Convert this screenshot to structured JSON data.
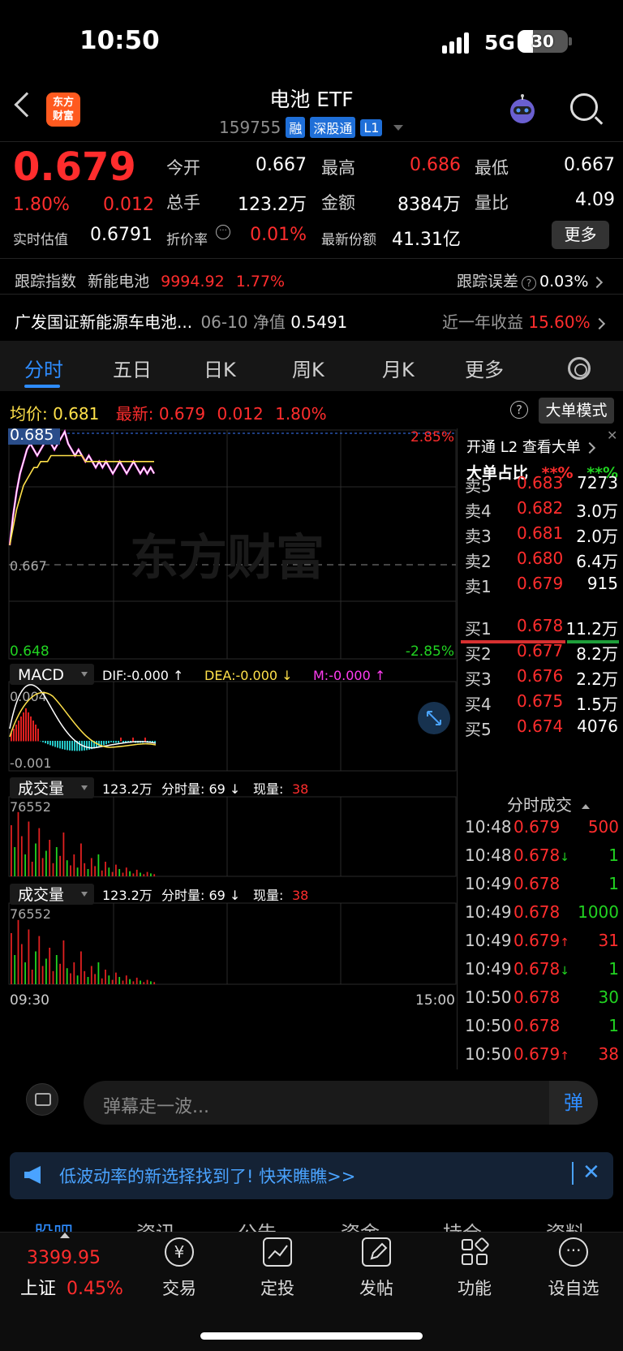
{
  "status": {
    "time": "10:50",
    "network": "5G",
    "battery": "30",
    "battery_level": 0.3
  },
  "header": {
    "title": "电池 ETF",
    "code": "159755",
    "tags": [
      "融",
      "深股通",
      "L1"
    ],
    "logo_text": "东方财富"
  },
  "quote": {
    "price": "0.679",
    "change_pct": "1.80%",
    "change_val": "0.012",
    "rows": [
      [
        {
          "label": "今开",
          "value": "0.667",
          "color": "white"
        },
        {
          "label": "最高",
          "value": "0.686",
          "color": "red"
        },
        {
          "label": "最低",
          "value": "0.667",
          "color": "white"
        }
      ],
      [
        {
          "label": "总手",
          "value": "123.2万",
          "color": "white"
        },
        {
          "label": "金额",
          "value": "8384万",
          "color": "white"
        },
        {
          "label": "量比",
          "value": "4.09",
          "color": "white"
        }
      ]
    ],
    "est_label": "实时估值",
    "est_value": "0.6791",
    "disc_label": "折价率",
    "disc_value": "0.01%",
    "share_label": "最新份额",
    "share_value": "41.31亿",
    "more": "更多"
  },
  "tracking": {
    "label": "跟踪指数",
    "index": "新能电池",
    "value": "9994.92",
    "pct": "1.77%",
    "err_label": "跟踪误差",
    "err_value": "0.03%"
  },
  "fund": {
    "name": "广发国证新能源车电池...",
    "date": "06-10",
    "nav_label": "净值",
    "nav": "0.5491",
    "ret_label": "近一年收益",
    "ret": "15.60%"
  },
  "tabs": [
    "分时",
    "五日",
    "日K",
    "周K",
    "月K",
    "更多"
  ],
  "avgline": {
    "avg_label": "均价:",
    "avg": "0.681",
    "latest_label": "最新:",
    "latest": "0.679",
    "chg": "0.012",
    "pct": "1.80%",
    "mode": "大单模式"
  },
  "chart": {
    "top_price": "0.685",
    "mid_price": "0.667",
    "low_price": "0.648",
    "top_pct": "2.85%",
    "low_pct": "-2.85%",
    "time_start": "09:30",
    "time_end": "15:00",
    "watermark": "东方财富",
    "macd": {
      "label": "MACD",
      "dif": "DIF:-0.000 ↑",
      "dea": "DEA:-0.000 ↓",
      "m": "M:-0.000 ↑",
      "top": "0.004",
      "low": "-0.001"
    },
    "volume": {
      "label": "成交量",
      "total": "123.2万",
      "fs_label": "分时量: 69 ↓",
      "now_label": "现量:",
      "now": "38",
      "max": "76552"
    }
  },
  "chart_data": {
    "type": "line",
    "price_range": [
      0.648,
      0.686
    ],
    "prev_close": 0.667,
    "price": [
      0.667,
      0.672,
      0.676,
      0.679,
      0.681,
      0.683,
      0.684,
      0.683,
      0.682,
      0.683,
      0.684,
      0.685,
      0.684,
      0.683,
      0.684,
      0.685,
      0.686,
      0.684,
      0.683,
      0.682,
      0.683,
      0.682,
      0.681,
      0.682,
      0.681,
      0.68,
      0.681,
      0.68,
      0.681,
      0.68,
      0.679,
      0.68,
      0.681,
      0.68,
      0.679,
      0.68,
      0.681,
      0.68,
      0.679,
      0.68,
      0.679,
      0.68,
      0.679
    ],
    "avg": [
      0.667,
      0.67,
      0.673,
      0.675,
      0.677,
      0.678,
      0.679,
      0.68,
      0.68,
      0.681,
      0.681,
      0.681,
      0.682,
      0.682,
      0.682,
      0.682,
      0.682,
      0.682,
      0.682,
      0.682,
      0.682,
      0.682,
      0.681,
      0.681,
      0.681,
      0.681,
      0.681,
      0.681,
      0.681,
      0.681,
      0.681,
      0.681,
      0.681,
      0.681,
      0.681,
      0.681,
      0.681,
      0.681,
      0.681,
      0.681,
      0.681,
      0.681,
      0.681
    ],
    "volume_max": 76552
  },
  "orderbook": {
    "l2_text": "开通 L2 查看大单",
    "big_label": "大单占比",
    "big_red": "**%",
    "big_green": "**%",
    "sells": [
      {
        "label": "卖5",
        "price": "0.683",
        "vol": "7273"
      },
      {
        "label": "卖4",
        "price": "0.682",
        "vol": "3.0万"
      },
      {
        "label": "卖3",
        "price": "0.681",
        "vol": "2.0万"
      },
      {
        "label": "卖2",
        "price": "0.680",
        "vol": "6.4万"
      },
      {
        "label": "卖1",
        "price": "0.679",
        "vol": "915"
      }
    ],
    "buys": [
      {
        "label": "买1",
        "price": "0.678",
        "vol": "11.2万"
      },
      {
        "label": "买2",
        "price": "0.677",
        "vol": "8.2万"
      },
      {
        "label": "买3",
        "price": "0.676",
        "vol": "2.2万"
      },
      {
        "label": "买4",
        "price": "0.675",
        "vol": "1.5万"
      },
      {
        "label": "买5",
        "price": "0.674",
        "vol": "4076"
      }
    ],
    "trades_title": "分时成交",
    "trades": [
      {
        "t": "10:48",
        "p": "0.679",
        "a": "",
        "v": "500",
        "vc": "red"
      },
      {
        "t": "10:48",
        "p": "0.678",
        "a": "↓",
        "v": "1",
        "vc": "green"
      },
      {
        "t": "10:49",
        "p": "0.678",
        "a": "",
        "v": "1",
        "vc": "green"
      },
      {
        "t": "10:49",
        "p": "0.678",
        "a": "",
        "v": "1000",
        "vc": "green"
      },
      {
        "t": "10:49",
        "p": "0.679",
        "a": "↑",
        "v": "31",
        "vc": "red"
      },
      {
        "t": "10:49",
        "p": "0.678",
        "a": "↓",
        "v": "1",
        "vc": "green"
      },
      {
        "t": "10:50",
        "p": "0.678",
        "a": "",
        "v": "30",
        "vc": "green"
      },
      {
        "t": "10:50",
        "p": "0.678",
        "a": "",
        "v": "1",
        "vc": "green"
      },
      {
        "t": "10:50",
        "p": "0.679",
        "a": "↑",
        "v": "38",
        "vc": "red"
      }
    ]
  },
  "danmu": {
    "placeholder": "弹幕走一波...",
    "btn": "弹"
  },
  "banner": {
    "text": "低波动率的新选择找到了! 快来瞧瞧>>"
  },
  "subtabs": [
    "股吧",
    "资讯",
    "公告",
    "资金",
    "持仓",
    "资料"
  ],
  "bottom": {
    "index_value": "3399.95",
    "index_name": "上证",
    "index_pct": "0.45%",
    "items": [
      "交易",
      "定投",
      "发帖",
      "功能",
      "设自选"
    ]
  }
}
